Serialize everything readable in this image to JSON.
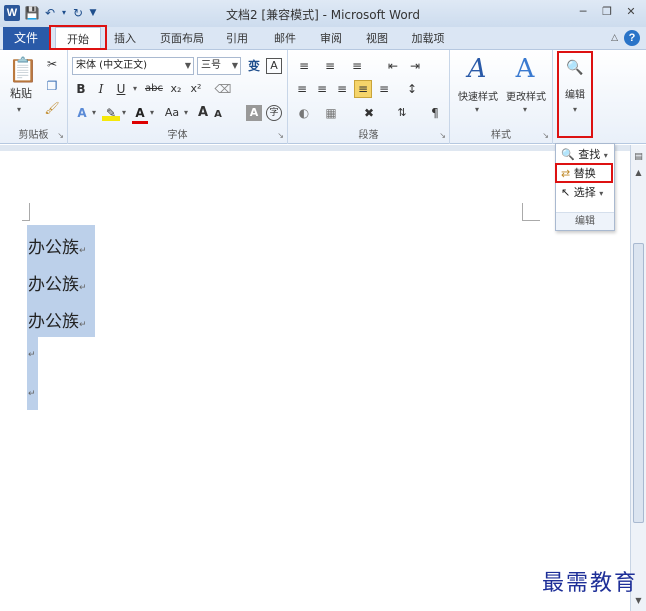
{
  "window": {
    "title": "文档2 [兼容模式] - Microsoft Word",
    "app_icon": "W",
    "qat_icons": [
      "save-icon",
      "undo-icon",
      "redo-icon",
      "customize-qat-icon"
    ]
  },
  "tabs": {
    "file": "文件",
    "items": [
      "开始",
      "插入",
      "页面布局",
      "引用",
      "邮件",
      "审阅",
      "视图",
      "加载项"
    ],
    "active": "开始"
  },
  "ribbon": {
    "clipboard": {
      "paste": "粘贴",
      "label": "剪贴板"
    },
    "font": {
      "font_name": "宋体 (中文正文)",
      "font_size": "三号",
      "label": "字体",
      "bold": "B",
      "italic": "I",
      "underline": "U",
      "strike": "abc",
      "subscript": "x₂",
      "superscript": "x²",
      "grow": "A",
      "shrink": "A",
      "change_case": "Aa",
      "char_border": "A",
      "enclose": "字"
    },
    "paragraph": {
      "label": "段落"
    },
    "styles": {
      "quick_styles": "快速样式",
      "change_styles": "更改样式",
      "label": "样式"
    },
    "editing": {
      "label": "编辑"
    }
  },
  "edit_menu": {
    "find": "查找",
    "replace": "替换",
    "select": "选择",
    "footer": "编辑"
  },
  "document": {
    "lines": [
      "办公族",
      "办公族",
      "办公族"
    ],
    "paragraph_mark": "↵"
  },
  "watermark": "最需教育",
  "colors": {
    "accent": "#2a5aa8",
    "highlight_box": "#dd1111",
    "selection": "#bcd0ea"
  }
}
